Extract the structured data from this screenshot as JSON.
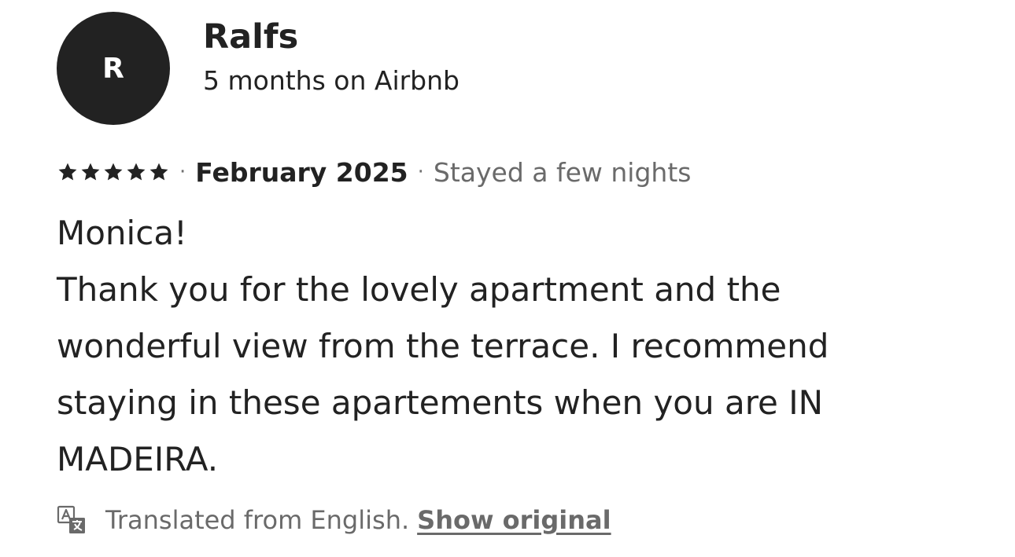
{
  "reviewer": {
    "initial": "R",
    "name": "Ralfs",
    "tenure": "5 months on Airbnb"
  },
  "review": {
    "rating": 5,
    "max_rating": 5,
    "separator": "·",
    "date": "February 2025",
    "stay_length": "Stayed a few nights",
    "greeting": "Monica!",
    "body": "Thank you for the lovely apartment and the wonderful view from the terrace. I recommend staying in these apartements when you are IN MADEIRA."
  },
  "translation": {
    "icon": "translate-icon",
    "note": "Translated from English.",
    "show_original_label": "Show original"
  },
  "colors": {
    "text_primary": "#222222",
    "text_secondary": "#6a6a6a",
    "avatar_bg": "#222222"
  }
}
